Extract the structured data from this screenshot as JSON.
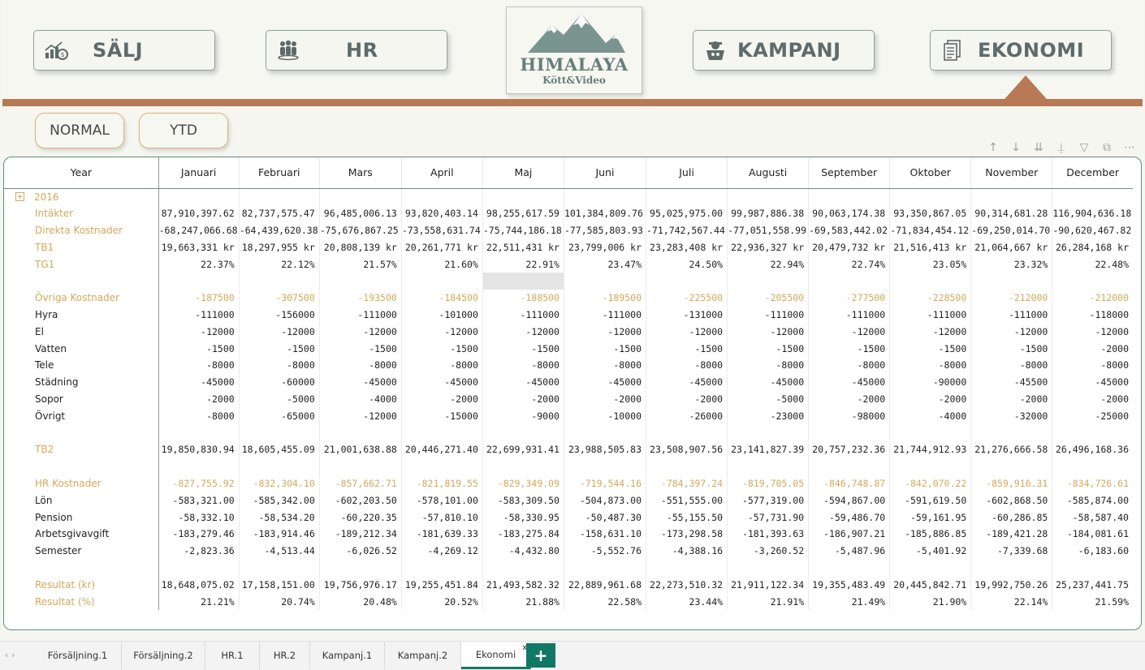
{
  "nav": {
    "salj": "SÄLJ",
    "hr": "HR",
    "kampanj": "KAMPANJ",
    "ekonomi": "EKONOMI"
  },
  "logo": {
    "title": "HIMALAYA",
    "subtitle": "Kött&Video"
  },
  "modes": {
    "normal": "NORMAL",
    "ytd": "YTD"
  },
  "table": {
    "year_header": "Year",
    "months": [
      "Januari",
      "Februari",
      "Mars",
      "April",
      "Maj",
      "Juni",
      "Juli",
      "Augusti",
      "September",
      "Oktober",
      "November",
      "December"
    ],
    "year_label": "2016",
    "rows": [
      {
        "label": "Intäkter",
        "gold": false,
        "values": [
          "87,910,397.62",
          "82,737,575.47",
          "96,485,006.13",
          "93,820,403.14",
          "98,255,617.59",
          "101,384,809.76",
          "95,025,975.00",
          "99,987,886.38",
          "90,063,174.38",
          "93,350,867.05",
          "90,314,681.28",
          "116,904,636.18"
        ]
      },
      {
        "label": "Direkta Kostnader",
        "gold": false,
        "values": [
          "-68,247,066.68",
          "-64,439,620.38",
          "-75,676,867.25",
          "-73,558,631.74",
          "-75,744,186.18",
          "-77,585,803.93",
          "-71,742,567.44",
          "-77,051,558.99",
          "-69,583,442.02",
          "-71,834,454.12",
          "-69,250,014.70",
          "-90,620,467.82"
        ]
      },
      {
        "label": "TB1",
        "gold": false,
        "values": [
          "19,663,331 kr",
          "18,297,955 kr",
          "20,808,139 kr",
          "20,261,771 kr",
          "22,511,431 kr",
          "23,799,006 kr",
          "23,283,408 kr",
          "22,936,327 kr",
          "20,479,732 kr",
          "21,516,413 kr",
          "21,064,667 kr",
          "26,284,168 kr"
        ]
      },
      {
        "label": "TG1",
        "gold": false,
        "values": [
          "22.37%",
          "22.12%",
          "21.57%",
          "21.60%",
          "22.91%",
          "23.47%",
          "24.50%",
          "22.94%",
          "22.74%",
          "23.05%",
          "23.32%",
          "22.48%"
        ]
      },
      {
        "label": "",
        "gold": false,
        "values": [
          "",
          "",
          "",
          "",
          "",
          "",
          "",
          "",
          "",
          "",
          "",
          ""
        ]
      },
      {
        "label": "Övriga Kostnader",
        "gold": true,
        "values": [
          "-187500",
          "-307500",
          "-193500",
          "-184500",
          "-188500",
          "-189500",
          "-225500",
          "-205500",
          "-277500",
          "-228500",
          "-212000",
          "-212000"
        ]
      },
      {
        "label": "Hyra",
        "gold": false,
        "values": [
          "-111000",
          "-156000",
          "-111000",
          "-101000",
          "-111000",
          "-111000",
          "-131000",
          "-111000",
          "-111000",
          "-111000",
          "-111000",
          "-118000"
        ]
      },
      {
        "label": "El",
        "gold": false,
        "values": [
          "-12000",
          "-12000",
          "-12000",
          "-12000",
          "-12000",
          "-12000",
          "-12000",
          "-12000",
          "-12000",
          "-12000",
          "-12000",
          "-12000"
        ]
      },
      {
        "label": "Vatten",
        "gold": false,
        "values": [
          "-1500",
          "-1500",
          "-1500",
          "-1500",
          "-1500",
          "-1500",
          "-1500",
          "-1500",
          "-1500",
          "-1500",
          "-1500",
          "-2000"
        ]
      },
      {
        "label": "Tele",
        "gold": false,
        "values": [
          "-8000",
          "-8000",
          "-8000",
          "-8000",
          "-8000",
          "-8000",
          "-8000",
          "-8000",
          "-8000",
          "-8000",
          "-8000",
          "-8000"
        ]
      },
      {
        "label": "Städning",
        "gold": false,
        "values": [
          "-45000",
          "-60000",
          "-45000",
          "-45000",
          "-45000",
          "-45000",
          "-45000",
          "-45000",
          "-45000",
          "-90000",
          "-45500",
          "-45000"
        ]
      },
      {
        "label": "Sopor",
        "gold": false,
        "values": [
          "-2000",
          "-5000",
          "-4000",
          "-2000",
          "-2000",
          "-2000",
          "-2000",
          "-5000",
          "-2000",
          "-2000",
          "-2000",
          "-2000"
        ]
      },
      {
        "label": "Övrigt",
        "gold": false,
        "values": [
          "-8000",
          "-65000",
          "-12000",
          "-15000",
          "-9000",
          "-10000",
          "-26000",
          "-23000",
          "-98000",
          "-4000",
          "-32000",
          "-25000"
        ]
      },
      {
        "label": "",
        "gold": false,
        "values": [
          "",
          "",
          "",
          "",
          "",
          "",
          "",
          "",
          "",
          "",
          "",
          ""
        ]
      },
      {
        "label": "TB2",
        "gold": false,
        "values": [
          "19,850,830.94",
          "18,605,455.09",
          "21,001,638.88",
          "20,446,271.40",
          "22,699,931.41",
          "23,988,505.83",
          "23,508,907.56",
          "23,141,827.39",
          "20,757,232.36",
          "21,744,912.93",
          "21,276,666.58",
          "26,496,168.36"
        ]
      },
      {
        "label": "",
        "gold": false,
        "values": [
          "",
          "",
          "",
          "",
          "",
          "",
          "",
          "",
          "",
          "",
          "",
          ""
        ]
      },
      {
        "label": "HR Kostnader",
        "gold": true,
        "values": [
          "-827,755.92",
          "-832,304.10",
          "-857,662.71",
          "-821,819.55",
          "-829,349.09",
          "-719,544.16",
          "-784,397.24",
          "-819,705.05",
          "-846,748.87",
          "-842,070.22",
          "-859,916.31",
          "-834,726.61"
        ]
      },
      {
        "label": "Lön",
        "gold": false,
        "values": [
          "-583,321.00",
          "-585,342.00",
          "-602,203.50",
          "-578,101.00",
          "-583,309.50",
          "-504,873.00",
          "-551,555.00",
          "-577,319.00",
          "-594,867.00",
          "-591,619.50",
          "-602,868.50",
          "-585,874.00"
        ]
      },
      {
        "label": "Pension",
        "gold": false,
        "values": [
          "-58,332.10",
          "-58,534.20",
          "-60,220.35",
          "-57,810.10",
          "-58,330.95",
          "-50,487.30",
          "-55,155.50",
          "-57,731.90",
          "-59,486.70",
          "-59,161.95",
          "-60,286.85",
          "-58,587.40"
        ]
      },
      {
        "label": "Arbetsgivavgift",
        "gold": false,
        "values": [
          "-183,279.46",
          "-183,914.46",
          "-189,212.34",
          "-181,639.33",
          "-183,275.84",
          "-158,631.10",
          "-173,298.58",
          "-181,393.63",
          "-186,907.21",
          "-185,886.85",
          "-189,421.28",
          "-184,081.61"
        ]
      },
      {
        "label": "Semester",
        "gold": false,
        "values": [
          "-2,823.36",
          "-4,513.44",
          "-6,026.52",
          "-4,269.12",
          "-4,432.80",
          "-5,552.76",
          "-4,388.16",
          "-3,260.52",
          "-5,487.96",
          "-5,401.92",
          "-7,339.68",
          "-6,183.60"
        ]
      },
      {
        "label": "",
        "gold": false,
        "values": [
          "",
          "",
          "",
          "",
          "",
          "",
          "",
          "",
          "",
          "",
          "",
          ""
        ]
      },
      {
        "label": "Resultat (kr)",
        "gold": false,
        "values": [
          "18,648,075.02",
          "17,158,151.00",
          "19,756,976.17",
          "19,255,451.84",
          "21,493,582.32",
          "22,889,961.68",
          "22,273,510.32",
          "21,911,122.34",
          "19,355,483.49",
          "20,445,842.71",
          "19,992,750.26",
          "25,237,441.75"
        ]
      },
      {
        "label": "Resultat (%)",
        "gold": false,
        "values": [
          "21.21%",
          "20.74%",
          "20.48%",
          "20.52%",
          "21.88%",
          "22.58%",
          "23.44%",
          "21.91%",
          "21.49%",
          "21.90%",
          "22.14%",
          "21.59%"
        ]
      }
    ]
  },
  "tabs": [
    "Försäljning.1",
    "Försäljning.2",
    "HR.1",
    "HR.2",
    "Kampanj.1",
    "Kampanj.2",
    "Ekonomi"
  ],
  "active_tab": "Ekonomi",
  "tab_close": "x",
  "tab_add": "+",
  "colors": {
    "gold": "#d4a85a",
    "brown": "#b77a55",
    "teal": "#117865",
    "slate": "#5d6b6a"
  }
}
